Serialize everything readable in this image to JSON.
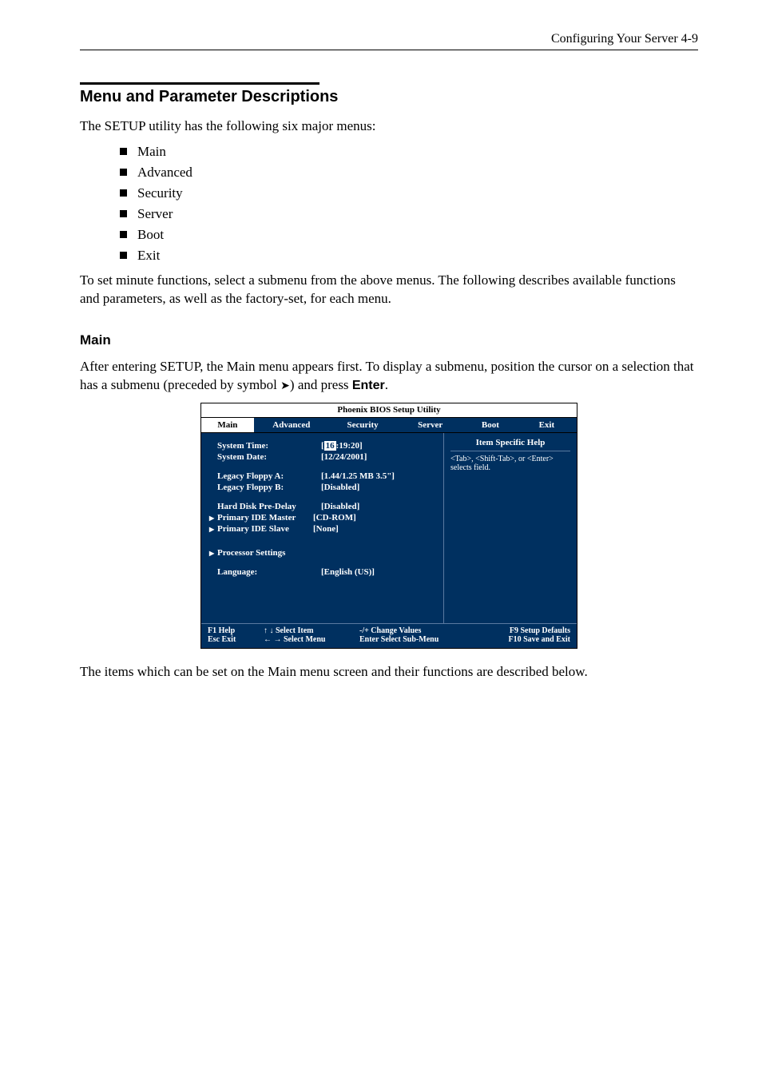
{
  "header": {
    "text": "Configuring Your Server   4-9"
  },
  "section": {
    "title": "Menu and Parameter Descriptions",
    "intro": "The SETUP utility has the following six major menus:",
    "bullets": [
      "Main",
      "Advanced",
      "Security",
      "Server",
      "Boot",
      "Exit"
    ],
    "para2": "To set minute functions, select a submenu from the above menus.    The following describes available functions and parameters, as well as the factory-set, for each menu."
  },
  "sub": {
    "title": "Main",
    "para_a": "After entering SETUP, the Main menu appears first.    To display a submenu, position the cursor on a selection that has a submenu (preceded by symbol ",
    "para_b": ") and press ",
    "enter": "Enter",
    "para_c": "."
  },
  "bios": {
    "title": "Phoenix BIOS Setup Utility",
    "tabs": [
      "Main",
      "Advanced",
      "Security",
      "Server",
      "Boot",
      "Exit"
    ],
    "rows": {
      "sys_time_l": "System Time:",
      "sys_time_v_pre": "[",
      "sys_time_cursor": "16",
      "sys_time_v_post": ":19:20]",
      "sys_date_l": "System Date:",
      "sys_date_v": "[12/24/2001]",
      "floppy_a_l": "Legacy Floppy A:",
      "floppy_a_v": "[1.44/1.25 MB 3.5\"]",
      "floppy_b_l": "Legacy Floppy B:",
      "floppy_b_v": "[Disabled]",
      "hdd_l": "Hard Disk Pre-Delay",
      "hdd_v": "[Disabled]",
      "pim_l": "Primary IDE Master",
      "pim_v": "[CD-ROM]",
      "pis_l": "Primary IDE Slave",
      "pis_v": "[None]",
      "proc_l": "Processor Settings",
      "lang_l": "Language:",
      "lang_v": "[English (US)]"
    },
    "help": {
      "head": "Item Specific Help",
      "text": "<Tab>, <Shift-Tab>, or <Enter> selects field."
    },
    "footer": {
      "r1c1": "F1   Help",
      "r1c2": "↑ ↓   Select Item",
      "r1c3": "-/+      Change Values",
      "r1c4": "F9   Setup Defaults",
      "r2c1": "Esc  Exit",
      "r2c2": "← →  Select Menu",
      "r2c3": "Enter  Select Sub-Menu",
      "r2c4": "F10  Save and Exit"
    }
  },
  "closing": "The items which can be set on the Main menu screen and their functions are described below."
}
